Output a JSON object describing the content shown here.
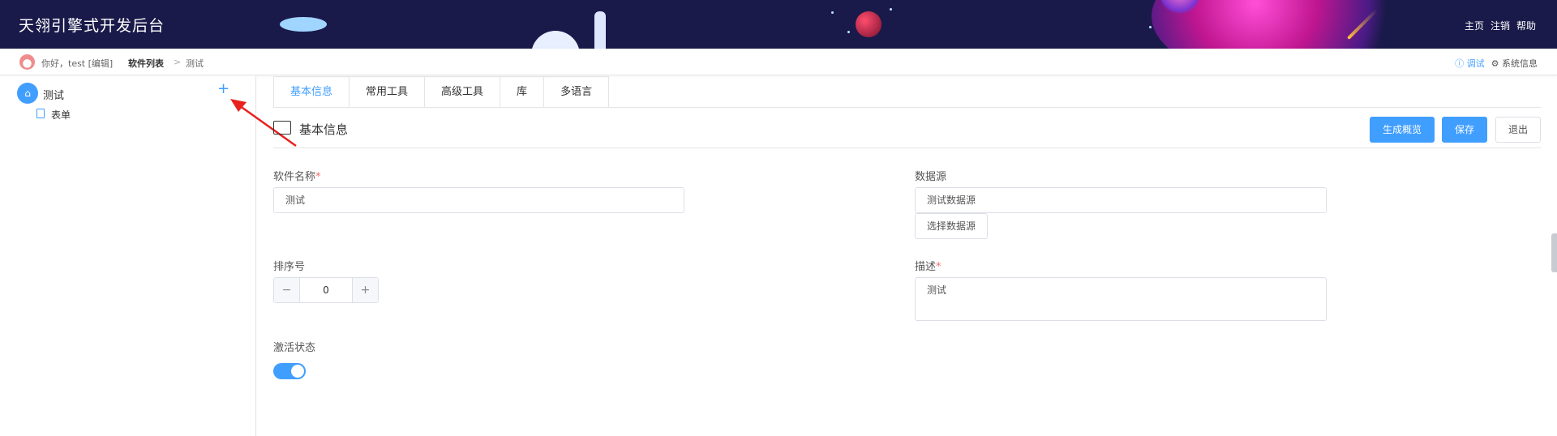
{
  "header": {
    "title": "天翎引擎式开发后台",
    "nav": [
      "主页",
      "注销",
      "帮助"
    ]
  },
  "breadcrumb": {
    "greeting": "你好，test",
    "edit": "[编辑]",
    "list": "软件列表",
    "separator": ">",
    "current": "测试",
    "debug": "ⓘ 调试",
    "system": "⚙ 系统信息"
  },
  "sidebar": {
    "root_label": "测试",
    "add": "+",
    "child_label": "表单"
  },
  "tabs": [
    "基本信息",
    "常用工具",
    "高级工具",
    "库",
    "多语言"
  ],
  "section": {
    "title": "基本信息",
    "generate_label": "生成概览",
    "save_label": "保存",
    "exit_label": "退出"
  },
  "form": {
    "name_label": "软件名称",
    "required_mark": "*",
    "name_value": "测试",
    "datasource_label": "数据源",
    "datasource_value": "测试数据源",
    "select_datasource_label": "选择数据源",
    "order_label": "排序号",
    "order_value": "0",
    "desc_label": "描述",
    "desc_value": "测试",
    "active_label": "激活状态",
    "active_value": true
  },
  "colors": {
    "accent": "#409eff",
    "header_bg": "#1a1a4a",
    "required": "#f56c6c"
  }
}
